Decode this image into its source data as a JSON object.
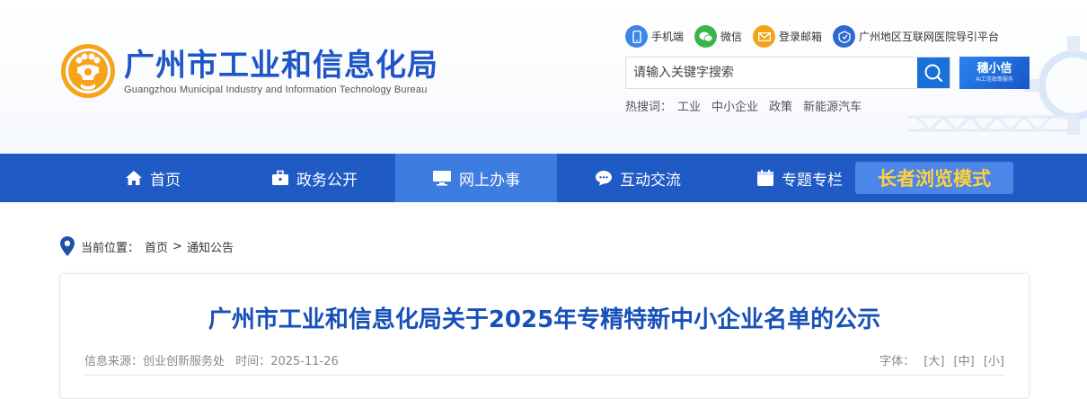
{
  "site": {
    "title_cn": "广州市工业和信息化局",
    "title_en": "Guangzhou Municipal Industry and Information Technology Bureau"
  },
  "quick_links": [
    {
      "label": "手机端",
      "icon": "phone-icon"
    },
    {
      "label": "微信",
      "icon": "wechat-icon"
    },
    {
      "label": "登录邮箱",
      "icon": "mail-icon"
    },
    {
      "label": "广州地区互联网医院导引平台",
      "icon": "hospital-icon"
    }
  ],
  "search": {
    "placeholder": "请输入关键字搜索"
  },
  "assistant": {
    "title": "穗小信",
    "subtitle": "AI工信政策服务"
  },
  "hot_search": {
    "label": "热搜词：",
    "terms": [
      "工业",
      "中小企业",
      "政策",
      "新能源汽车"
    ]
  },
  "nav": {
    "items": [
      {
        "label": "首页",
        "icon": "home-icon"
      },
      {
        "label": "政务公开",
        "icon": "briefcase-icon"
      },
      {
        "label": "网上办事",
        "icon": "monitor-icon"
      },
      {
        "label": "互动交流",
        "icon": "chat-icon"
      },
      {
        "label": "专题专栏",
        "icon": "calendar-icon"
      }
    ],
    "active_index": 2,
    "elder_mode": "长者浏览模式"
  },
  "breadcrumb": {
    "label": "当前位置：",
    "items": [
      "首页",
      "通知公告"
    ],
    "separator": ">"
  },
  "article": {
    "title": "广州市工业和信息化局关于2025年专精特新中小企业名单的公示",
    "source_label": "信息来源：",
    "source": "创业创新服务处",
    "time_label": "时间：",
    "time": "2025-11-26",
    "font_label": "字体：",
    "font_sizes": [
      "[大]",
      "[中]",
      "[小]"
    ]
  },
  "colors": {
    "brand_blue": "#1f5ac5",
    "nav_active": "#3e7de0",
    "title_blue": "#1650b8",
    "elder_text": "#ffd23c"
  }
}
